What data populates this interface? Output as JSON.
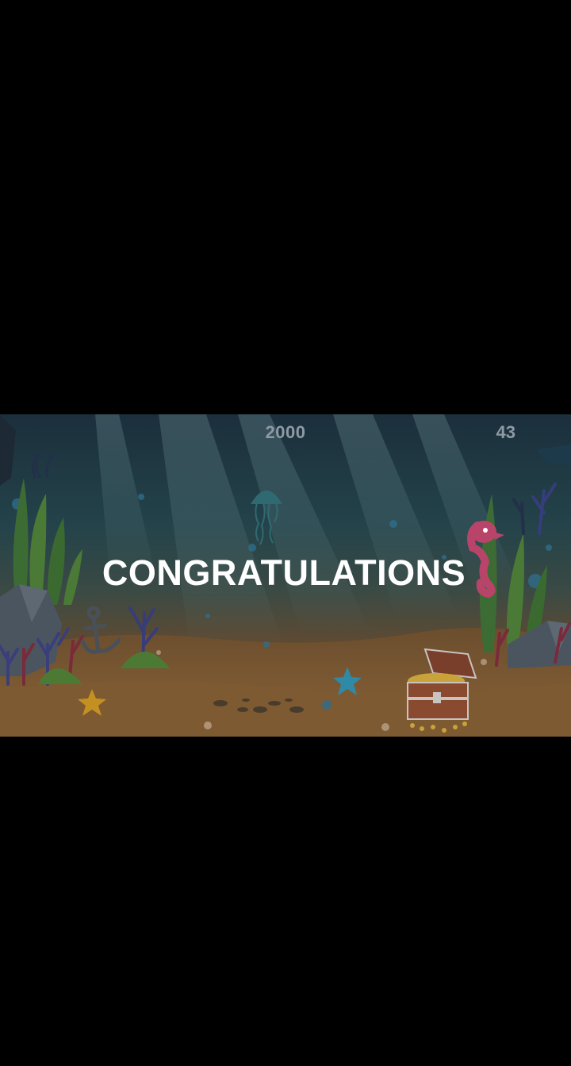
{
  "hud": {
    "score": "2000",
    "timer": "43"
  },
  "overlay": {
    "message": "CONGRATULATIONS"
  },
  "colors": {
    "background": "#000000",
    "water_top": "#1d3440",
    "water_mid": "#2a4a4e",
    "sand": "#7a5a32",
    "hud_text": "#8f9aa2",
    "message_text": "#ffffff"
  }
}
